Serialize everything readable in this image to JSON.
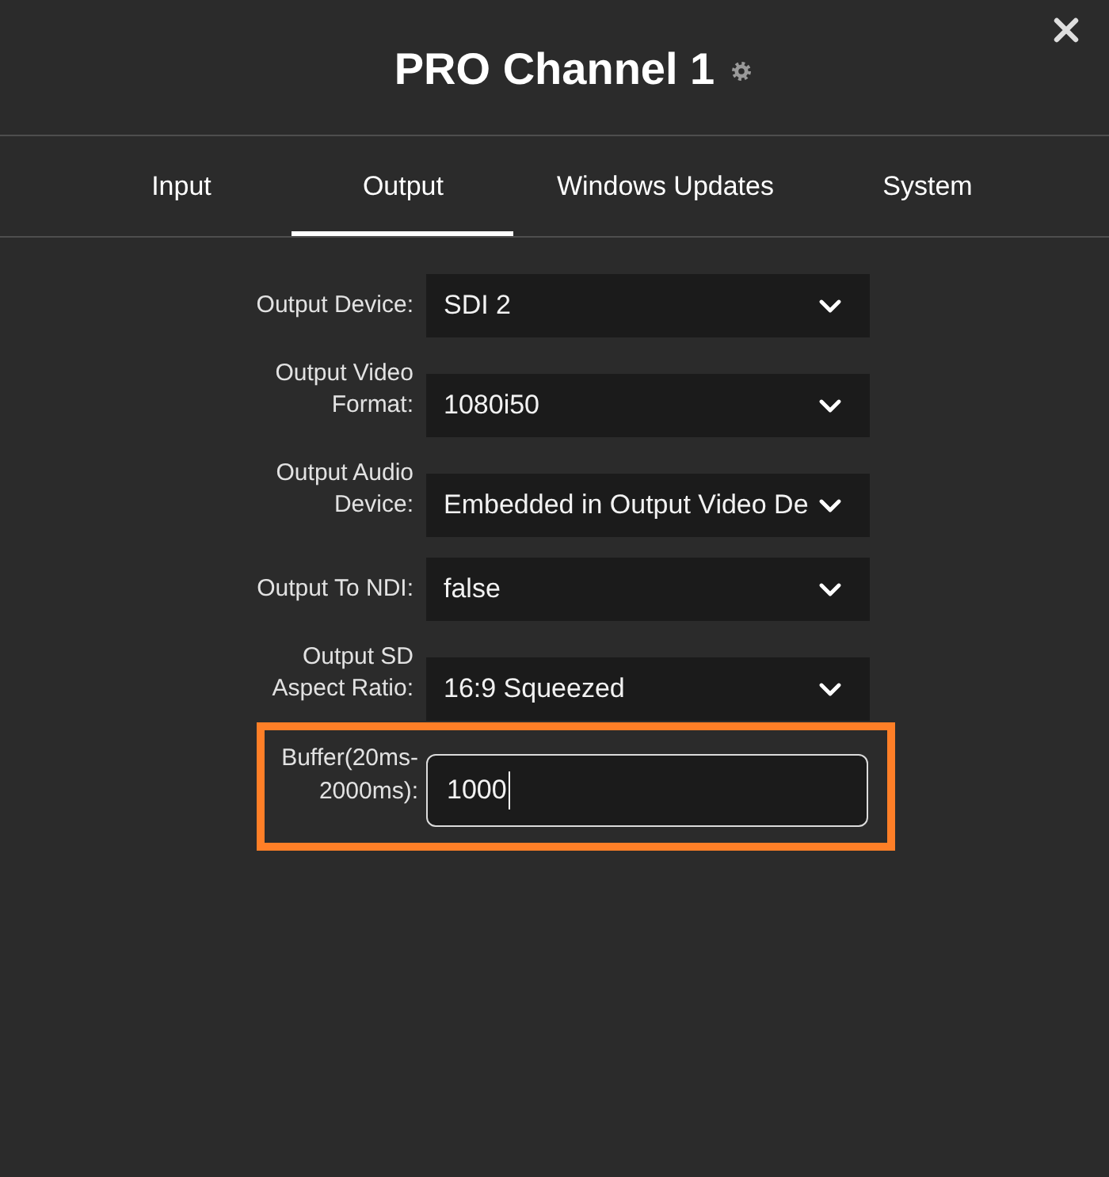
{
  "window": {
    "title": "PRO Channel 1"
  },
  "tabs": [
    {
      "label": "Input",
      "selected": false
    },
    {
      "label": "Output",
      "selected": true
    },
    {
      "label": "Windows Updates",
      "selected": false
    },
    {
      "label": "System",
      "selected": false
    }
  ],
  "fields": [
    {
      "kind": "select",
      "label": "Output Device:",
      "value": "SDI 2",
      "focused": false,
      "highlighted": false
    },
    {
      "kind": "select",
      "label": "Output Video Format:",
      "value": "1080i50",
      "focused": false,
      "highlighted": false
    },
    {
      "kind": "select",
      "label": "Output Audio Device:",
      "value": "Embedded in Output Video De",
      "focused": false,
      "highlighted": false
    },
    {
      "kind": "select",
      "label": "Output To NDI:",
      "value": "false",
      "focused": false,
      "highlighted": false
    },
    {
      "kind": "select",
      "label": "Output SD Aspect Ratio:",
      "value": "16:9 Squeezed",
      "focused": false,
      "highlighted": false
    },
    {
      "kind": "text",
      "label": "Buffer(20ms-2000ms):",
      "value": "1000",
      "focused": true,
      "highlighted": true
    }
  ]
}
